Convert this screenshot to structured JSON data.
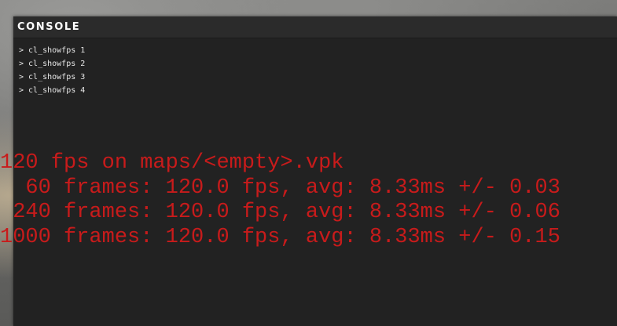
{
  "console": {
    "title": "CONSOLE",
    "history": [
      "> cl_showfps 1",
      "> cl_showfps 2",
      "> cl_showfps 3",
      "> cl_showfps 4"
    ]
  },
  "fps_overlay": {
    "color": "#c81b1b",
    "lines": [
      "120 fps on maps/<empty>.vpk",
      "  60 frames: 120.0 fps, avg: 8.33ms +/- 0.03",
      " 240 frames: 120.0 fps, avg: 8.33ms +/- 0.06",
      "1000 frames: 120.0 fps, avg: 8.33ms +/- 0.15"
    ]
  }
}
